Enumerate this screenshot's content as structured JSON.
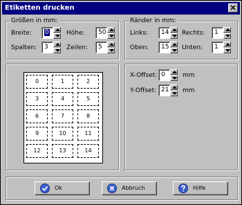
{
  "window": {
    "title": "Etiketten drucken"
  },
  "sizes": {
    "legend": "Größen in mm:",
    "breite": {
      "label": "Breite:",
      "value": "0"
    },
    "hoehe": {
      "label": "Höhe:",
      "value": "50"
    },
    "spalten": {
      "label": "Spalten:",
      "value": "3"
    },
    "zeilen": {
      "label": "Zeilen:",
      "value": "5"
    }
  },
  "margins": {
    "legend": "Ränder in mm:",
    "links": {
      "label": "Links:",
      "value": "14"
    },
    "rechts": {
      "label": "Rechts:",
      "value": "1"
    },
    "oben": {
      "label": "Oben:",
      "value": "15"
    },
    "unten": {
      "label": "Unten:",
      "value": "1"
    }
  },
  "offset": {
    "x": {
      "label": "X-Offset:",
      "value": "0",
      "unit": "mm"
    },
    "y": {
      "label": "Y-Offset:",
      "value": "21",
      "unit": "mm"
    }
  },
  "preview": {
    "labels": [
      "0",
      "1",
      "2",
      "3",
      "4",
      "5",
      "6",
      "7",
      "8",
      "9",
      "10",
      "11",
      "12",
      "13",
      "14"
    ]
  },
  "buttons": {
    "ok": "Ok",
    "abbruch": "Abbruch",
    "hilfe": "Hilfe"
  }
}
